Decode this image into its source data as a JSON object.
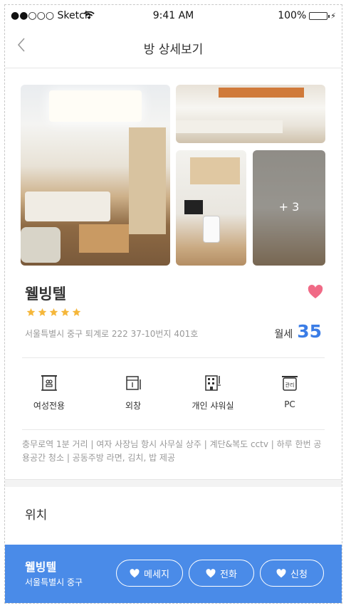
{
  "status_bar": {
    "carrier": "●●○○○ Sketch",
    "time": "9:41 AM",
    "battery": "100%"
  },
  "nav": {
    "title": "방 상세보기",
    "back_icon": "chevron-left-icon"
  },
  "gallery": {
    "more_label": "+ 3"
  },
  "room": {
    "name": "웰빙텔",
    "rating": 5,
    "address": "서울특별시 중구 퇴계로 222 37-10번지 401호",
    "price_label": "월세",
    "price_value": "35"
  },
  "amenities": [
    {
      "label": "여성전용",
      "icon": "building-women-icon"
    },
    {
      "label": "외창",
      "icon": "window-icon"
    },
    {
      "label": "개인 샤워실",
      "icon": "shower-building-icon"
    },
    {
      "label": "PC",
      "icon": "management-icon"
    }
  ],
  "description": "충무로역 1분 거리 | 여자 사장님 항시 사무실 상주 | 계단&복도 cctv | 하루 한번 공용공간 청소 | 공동주방 라면, 김치, 밥 제공",
  "location_title": "위치",
  "bottom_bar": {
    "name": "웰빙텔",
    "address": "서울특별시 중구",
    "buttons": [
      "메세지",
      "전화",
      "신청"
    ]
  },
  "colors": {
    "accent": "#4a8be8",
    "price": "#3b7de6",
    "heart": "#f06a86",
    "star": "#f5b73b"
  }
}
